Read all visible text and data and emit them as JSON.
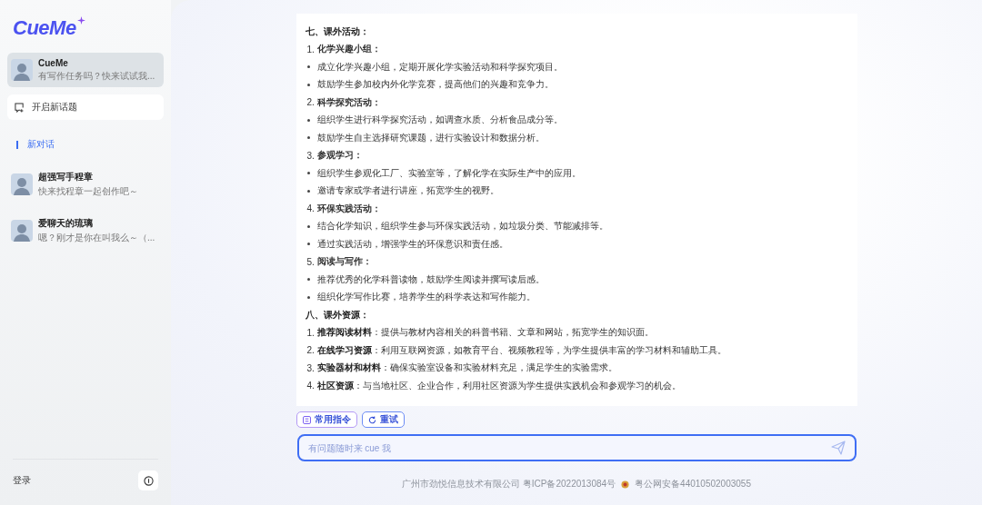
{
  "sidebar": {
    "logo": "CueMe",
    "pinned": {
      "name": "CueMe",
      "preview": "有写作任务吗？快来试试我...",
      "selected": true
    },
    "new_topic_button": "开启新话题",
    "section_label": "新对话",
    "chats": [
      {
        "name": "超强写手程章",
        "preview": "快来找程章一起创作吧～",
        "selected": false
      },
      {
        "name": "爱聊天的琉璃",
        "preview": "嗯？刚才是你在叫我么～（...",
        "selected": false
      }
    ],
    "login": "登录"
  },
  "content": [
    {
      "kind": "heading",
      "text": "七、课外活动："
    },
    {
      "kind": "numbered",
      "number": "1.",
      "text": "化学兴趣小组："
    },
    {
      "kind": "bullet",
      "text": "成立化学兴趣小组，定期开展化学实验活动和科学探究项目。"
    },
    {
      "kind": "bullet",
      "text": "鼓励学生参加校内外化学竞赛，提高他们的兴趣和竞争力。"
    },
    {
      "kind": "numbered",
      "number": "2.",
      "text": "科学探究活动："
    },
    {
      "kind": "bullet",
      "text": "组织学生进行科学探究活动，如调查水质、分析食品成分等。"
    },
    {
      "kind": "bullet",
      "text": "鼓励学生自主选择研究课题，进行实验设计和数据分析。"
    },
    {
      "kind": "numbered",
      "number": "3.",
      "text": "参观学习："
    },
    {
      "kind": "bullet",
      "text": "组织学生参观化工厂、实验室等，了解化学在实际生产中的应用。"
    },
    {
      "kind": "bullet",
      "text": "邀请专家或学者进行讲座，拓宽学生的视野。"
    },
    {
      "kind": "numbered",
      "number": "4.",
      "text": "环保实践活动："
    },
    {
      "kind": "bullet",
      "text": "结合化学知识，组织学生参与环保实践活动，如垃圾分类、节能减排等。"
    },
    {
      "kind": "bullet",
      "text": "通过实践活动，增强学生的环保意识和责任感。"
    },
    {
      "kind": "numbered",
      "number": "5.",
      "text": "阅读与写作："
    },
    {
      "kind": "bullet",
      "text": "推荐优秀的化学科普读物，鼓励学生阅读并撰写读后感。"
    },
    {
      "kind": "bullet",
      "text": "组织化学写作比赛，培养学生的科学表达和写作能力。"
    },
    {
      "kind": "heading",
      "text": "八、课外资源："
    },
    {
      "kind": "resource",
      "number": "1.",
      "text": "**推荐阅读材料**：提供与教材内容相关的科普书籍、文章和网站，拓宽学生的知识面。"
    },
    {
      "kind": "resource",
      "number": "2.",
      "text": "**在线学习资源**：利用互联网资源，如教育平台、视频教程等，为学生提供丰富的学习材料和辅助工具。"
    },
    {
      "kind": "resource",
      "number": "3.",
      "text": "**实验器材和材料**：确保实验室设备和实验材料充足，满足学生的实验需求。"
    },
    {
      "kind": "resource",
      "number": "4.",
      "text": "**社区资源**：与当地社区、企业合作，利用社区资源为学生提供实践机会和参观学习的机会。"
    }
  ],
  "chips": [
    "常用指令",
    "重试"
  ],
  "input": {
    "placeholder": "有问题随时来 cue 我"
  },
  "footer": {
    "company": "广州市劲悦信息技术有限公司 粤ICP备2022013084号",
    "police": "粤公网安备44010502003055"
  }
}
